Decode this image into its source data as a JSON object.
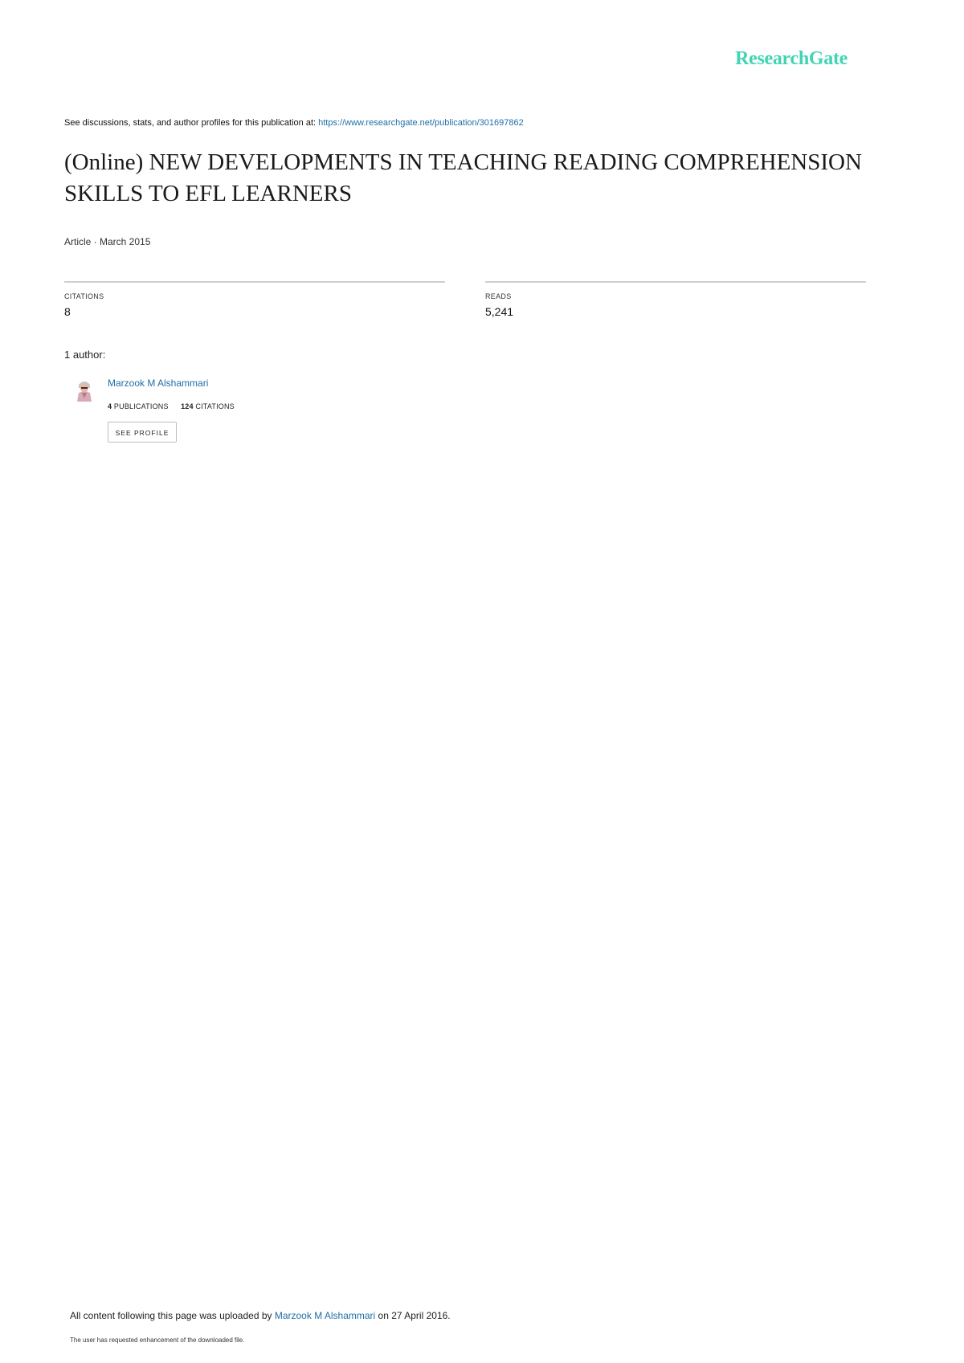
{
  "brand": {
    "logo_text": "ResearchGate"
  },
  "header": {
    "discussion_text": "See discussions, stats, and author profiles for this publication at: ",
    "publication_url": "https://www.researchgate.net/publication/301697862"
  },
  "publication": {
    "title": "(Online) NEW DEVELOPMENTS IN TEACHING READING COMPREHENSION SKILLS TO EFL LEARNERS",
    "meta": "Article · March 2015"
  },
  "stats": {
    "citations_label": "CITATIONS",
    "citations_value": "8",
    "reads_label": "READS",
    "reads_value": "5,241"
  },
  "authors": {
    "count_label": "1 author:",
    "list": [
      {
        "name": "Marzook M Alshammari",
        "publications_count": "4",
        "publications_label": "PUBLICATIONS",
        "citations_count": "124",
        "citations_label": "CITATIONS",
        "profile_button": "SEE PROFILE"
      }
    ]
  },
  "footer": {
    "upload_prefix": "All content following this page was uploaded by ",
    "uploader_name": "Marzook M Alshammari",
    "upload_suffix": " on 27 April 2016.",
    "note": "The user has requested enhancement of the downloaded file."
  },
  "colors": {
    "brand": "#40d4b3",
    "link": "#1f6fa6",
    "rule": "#cfcfcf"
  }
}
